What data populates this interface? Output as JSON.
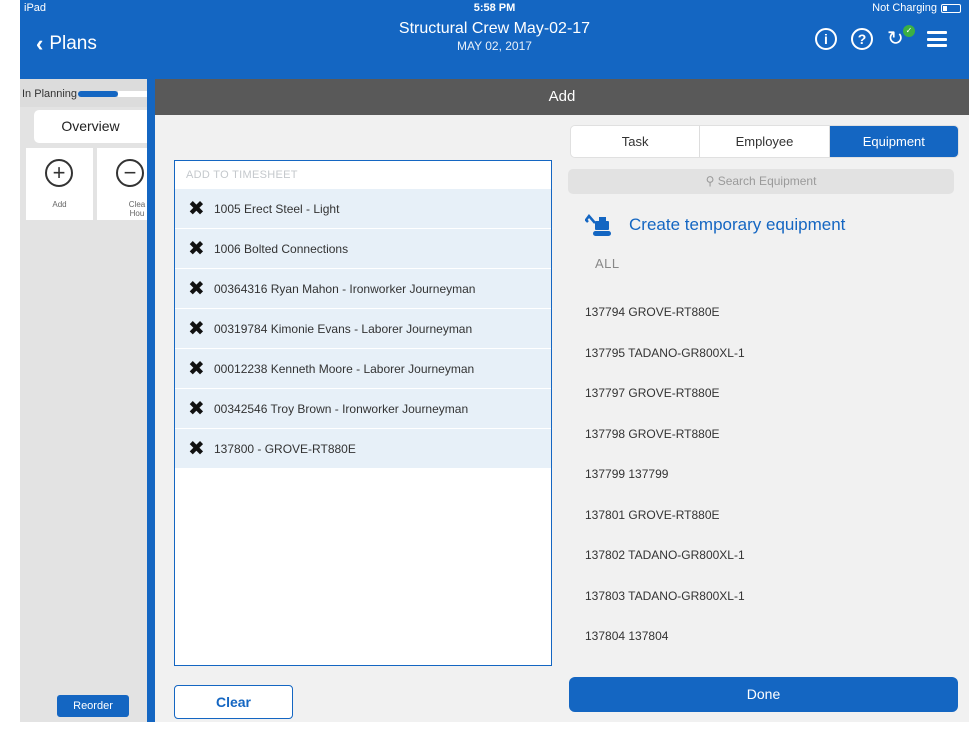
{
  "status_bar": {
    "carrier": "iPad",
    "time": "5:58 PM",
    "battery_text": "Not Charging"
  },
  "nav": {
    "back_label": "Plans",
    "title": "Structural Crew May-02-17",
    "subtitle": "MAY 02, 2017",
    "info_icon": "info-icon",
    "help_icon": "help-icon",
    "sync_icon": "sync-icon",
    "menu_icon": "menu-icon"
  },
  "sidebar": {
    "status_label": "In Planning",
    "overview_tab": "Overview",
    "tiles": [
      {
        "label": "Add",
        "icon": "plus-circle-icon"
      },
      {
        "label": "Clea Hou",
        "icon": "minus-circle-icon"
      }
    ],
    "reorder_label": "Reorder"
  },
  "main": {
    "header": "Add",
    "timesheet": {
      "header": "ADD TO TIMESHEET",
      "rows": [
        "1005 Erect Steel - Light",
        "1006 Bolted Connections",
        "00364316 Ryan Mahon - Ironworker Journeyman",
        "00319784 Kimonie Evans - Laborer Journeyman",
        "00012238 Kenneth Moore - Laborer Journeyman",
        "00342546 Troy Brown - Ironworker Journeyman",
        "137800 - GROVE-RT880E"
      ]
    },
    "clear_label": "Clear",
    "tabs": [
      "Task",
      "Employee",
      "Equipment"
    ],
    "active_tab": "Equipment",
    "search_placeholder": "Search Equipment",
    "create_temp_label": "Create temporary equipment",
    "filter_label": "ALL",
    "equipment": [
      "137794 GROVE-RT880E",
      "137795 TADANO-GR800XL-1",
      "137797 GROVE-RT880E",
      "137798 GROVE-RT880E",
      "137799 137799",
      "137801 GROVE-RT880E",
      "137802 TADANO-GR800XL-1",
      "137803 TADANO-GR800XL-1",
      "137804 137804"
    ],
    "done_label": "Done"
  },
  "colors": {
    "brand_blue": "#1466c2",
    "header_gray": "#595959"
  }
}
